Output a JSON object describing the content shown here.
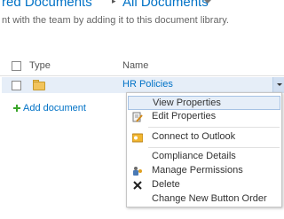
{
  "breadcrumb": {
    "part1": "red Documents",
    "separator": "▸",
    "part2": "All Documents"
  },
  "description": "nt with the team by adding it to this document library.",
  "list": {
    "columns": {
      "type": "Type",
      "name": "Name"
    },
    "rows": [
      {
        "icon": "folder-icon",
        "name": "HR Policies"
      }
    ],
    "add_document": "Add document"
  },
  "context_menu": {
    "items": [
      {
        "label": "View Properties",
        "icon": "",
        "highlighted": true
      },
      {
        "label": "Edit Properties",
        "icon": "edit-properties-icon"
      },
      {
        "label": "Connect to Outlook",
        "icon": "outlook-icon"
      },
      {
        "label": "Compliance Details",
        "icon": ""
      },
      {
        "label": "Manage Permissions",
        "icon": "manage-permissions-icon"
      },
      {
        "label": "Delete",
        "icon": "delete-x-icon"
      },
      {
        "label": "Change New Button Order",
        "icon": ""
      }
    ]
  },
  "colors": {
    "link": "#0072c6",
    "row_highlight": "#e6eef8",
    "menu_highlight_border": "#a6c2e4",
    "add_icon": "#3aa52b"
  }
}
